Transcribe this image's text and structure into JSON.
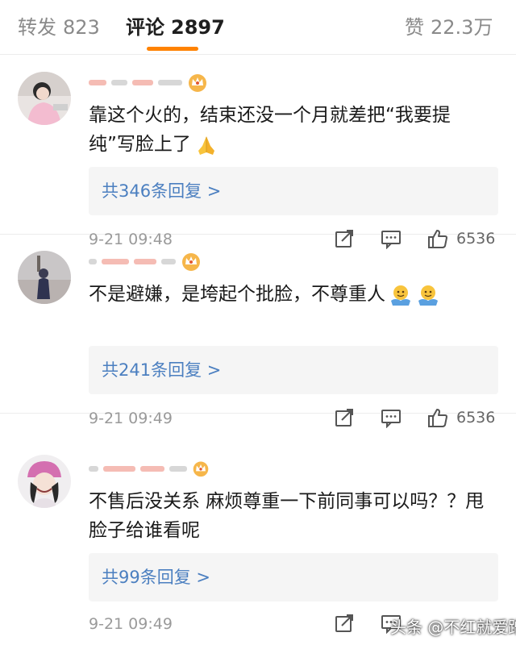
{
  "tabs": [
    {
      "label": "转发",
      "count": "823"
    },
    {
      "label": "评论",
      "count": "2897"
    },
    {
      "label": "赞",
      "count": "22.3万"
    }
  ],
  "comments": [
    {
      "text": "靠这个火的，结束还没一个月就差把“我要提纯”写脸上了",
      "emoji": "folded-hands",
      "replies": "共346条回复 >",
      "time": "9-21 09:48",
      "likes": "6536"
    },
    {
      "text": "不是避嫌，是垮起个批脸，不尊重人",
      "emoji": "shrug-face",
      "replies": "共241条回复 >",
      "time": "9-21 09:49",
      "likes": "6536"
    },
    {
      "text": "不售后没关系 麻烦尊重一下前同事可以吗？？甩脸子给谁看呢",
      "emoji": "",
      "replies": "共99条回复 >",
      "time": "9-21 09:49",
      "likes": ""
    }
  ],
  "watermark": "头条 @不红就爱蹭",
  "colors": {
    "accent": "#ff8200",
    "link": "#4b7fc0",
    "reply_bg": "#f5f5f5",
    "crown": "#f6b64a"
  }
}
